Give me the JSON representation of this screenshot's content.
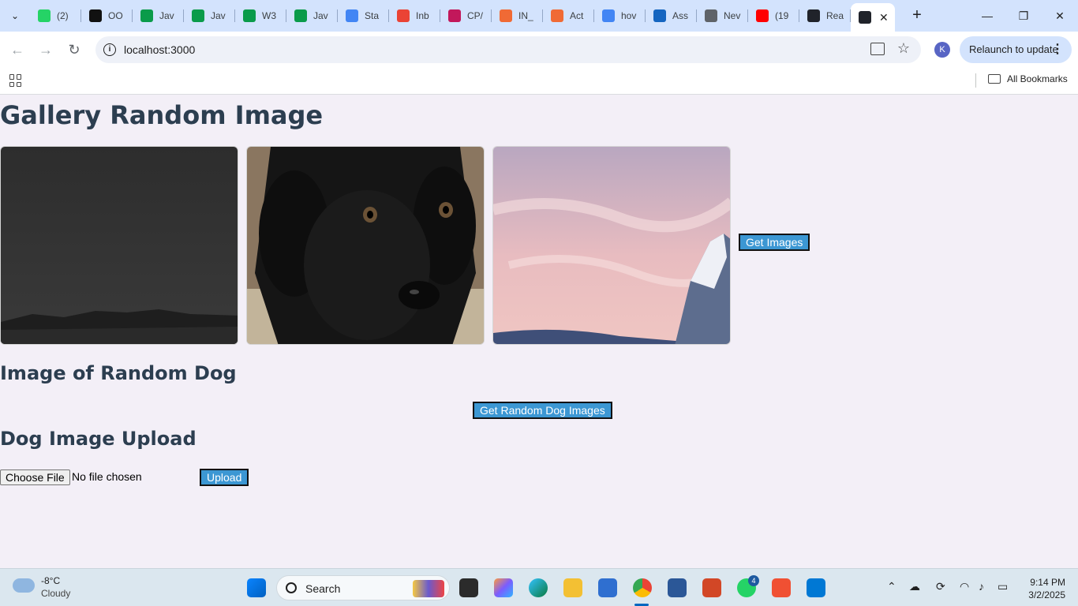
{
  "browser": {
    "tabs": [
      {
        "title": "(2)",
        "favicon": "whatsapp-icon",
        "color": "#25d366"
      },
      {
        "title": "OO",
        "favicon": "openai-icon",
        "color": "#111111"
      },
      {
        "title": "Jav",
        "favicon": "w-icon",
        "color": "#0a9b4a"
      },
      {
        "title": "Jav",
        "favicon": "w-icon",
        "color": "#0a9b4a"
      },
      {
        "title": "W3",
        "favicon": "w-icon",
        "color": "#0a9b4a"
      },
      {
        "title": "Jav",
        "favicon": "w-icon",
        "color": "#0a9b4a"
      },
      {
        "title": "Sta",
        "favicon": "docs-icon",
        "color": "#4285f4"
      },
      {
        "title": "Inb",
        "favicon": "gmail-icon",
        "color": "#ea4335"
      },
      {
        "title": "CP/",
        "favicon": "diamond-icon",
        "color": "#c2185b"
      },
      {
        "title": "IN_",
        "favicon": "asana-icon",
        "color": "#f06a35"
      },
      {
        "title": "Act",
        "favicon": "asana-icon",
        "color": "#f06a35"
      },
      {
        "title": "hov",
        "favicon": "google-icon",
        "color": "#4285f4"
      },
      {
        "title": "Ass",
        "favicon": "a-icon",
        "color": "#1565c0"
      },
      {
        "title": "Nev",
        "favicon": "chrome-icon",
        "color": "#5f6368"
      },
      {
        "title": "(19",
        "favicon": "youtube-icon",
        "color": "#ff0000"
      },
      {
        "title": "Rea",
        "favicon": "react-icon",
        "color": "#20232a"
      }
    ],
    "url": "localhost:3000",
    "avatar_letter": "K",
    "relaunch_label": "Relaunch to update",
    "bookmarks_label": "All Bookmarks"
  },
  "page": {
    "title": "Gallery Random Image",
    "get_images_button": "Get Images",
    "random_dog_heading": "Image of Random Dog",
    "random_dog_button": "Get Random Dog Images",
    "upload_heading": "Dog Image Upload",
    "choose_file_button": "Choose File",
    "file_status": "No file chosen",
    "upload_button": "Upload",
    "accent_color": "#3c97d3"
  },
  "taskbar": {
    "weather_temp": "-8°C",
    "weather_condition": "Cloudy",
    "search_label": "Search",
    "whatsapp_badge": "4",
    "time": "9:14 PM",
    "date": "3/2/2025"
  }
}
